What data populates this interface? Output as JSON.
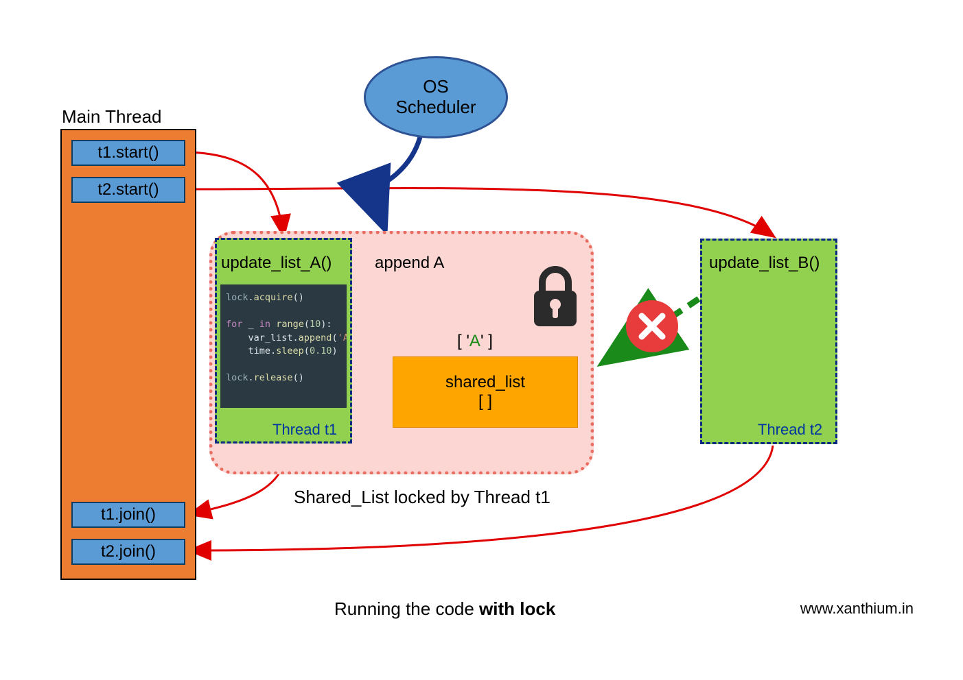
{
  "main_thread": {
    "title": "Main Thread",
    "t1_start": "t1.start()",
    "t2_start": "t2.start()",
    "t1_join": "t1.join()",
    "t2_join": "t2.join()"
  },
  "scheduler": {
    "label": "OS\nScheduler"
  },
  "locked_region": {
    "label": "Shared_List locked by Thread t1"
  },
  "thread_t1": {
    "func": "update_list_A()",
    "name": "Thread t1"
  },
  "code": {
    "line1": "lock.acquire()",
    "line2": "for _ in range(10):",
    "line3": "    var_list.append('A')",
    "line4": "    time.sleep(0.10)",
    "line5": "lock.release()"
  },
  "thread_t2": {
    "func": "update_list_B()",
    "name": "Thread t2"
  },
  "shared_list": {
    "title": "shared_list",
    "empty": "[ ]",
    "value_bracket_open": "[ '",
    "value_a": "A",
    "value_bracket_close": "' ]"
  },
  "append_label": "append A",
  "caption_pre": "Running the code ",
  "caption_bold": "with lock",
  "website": "www.xanthium.in"
}
